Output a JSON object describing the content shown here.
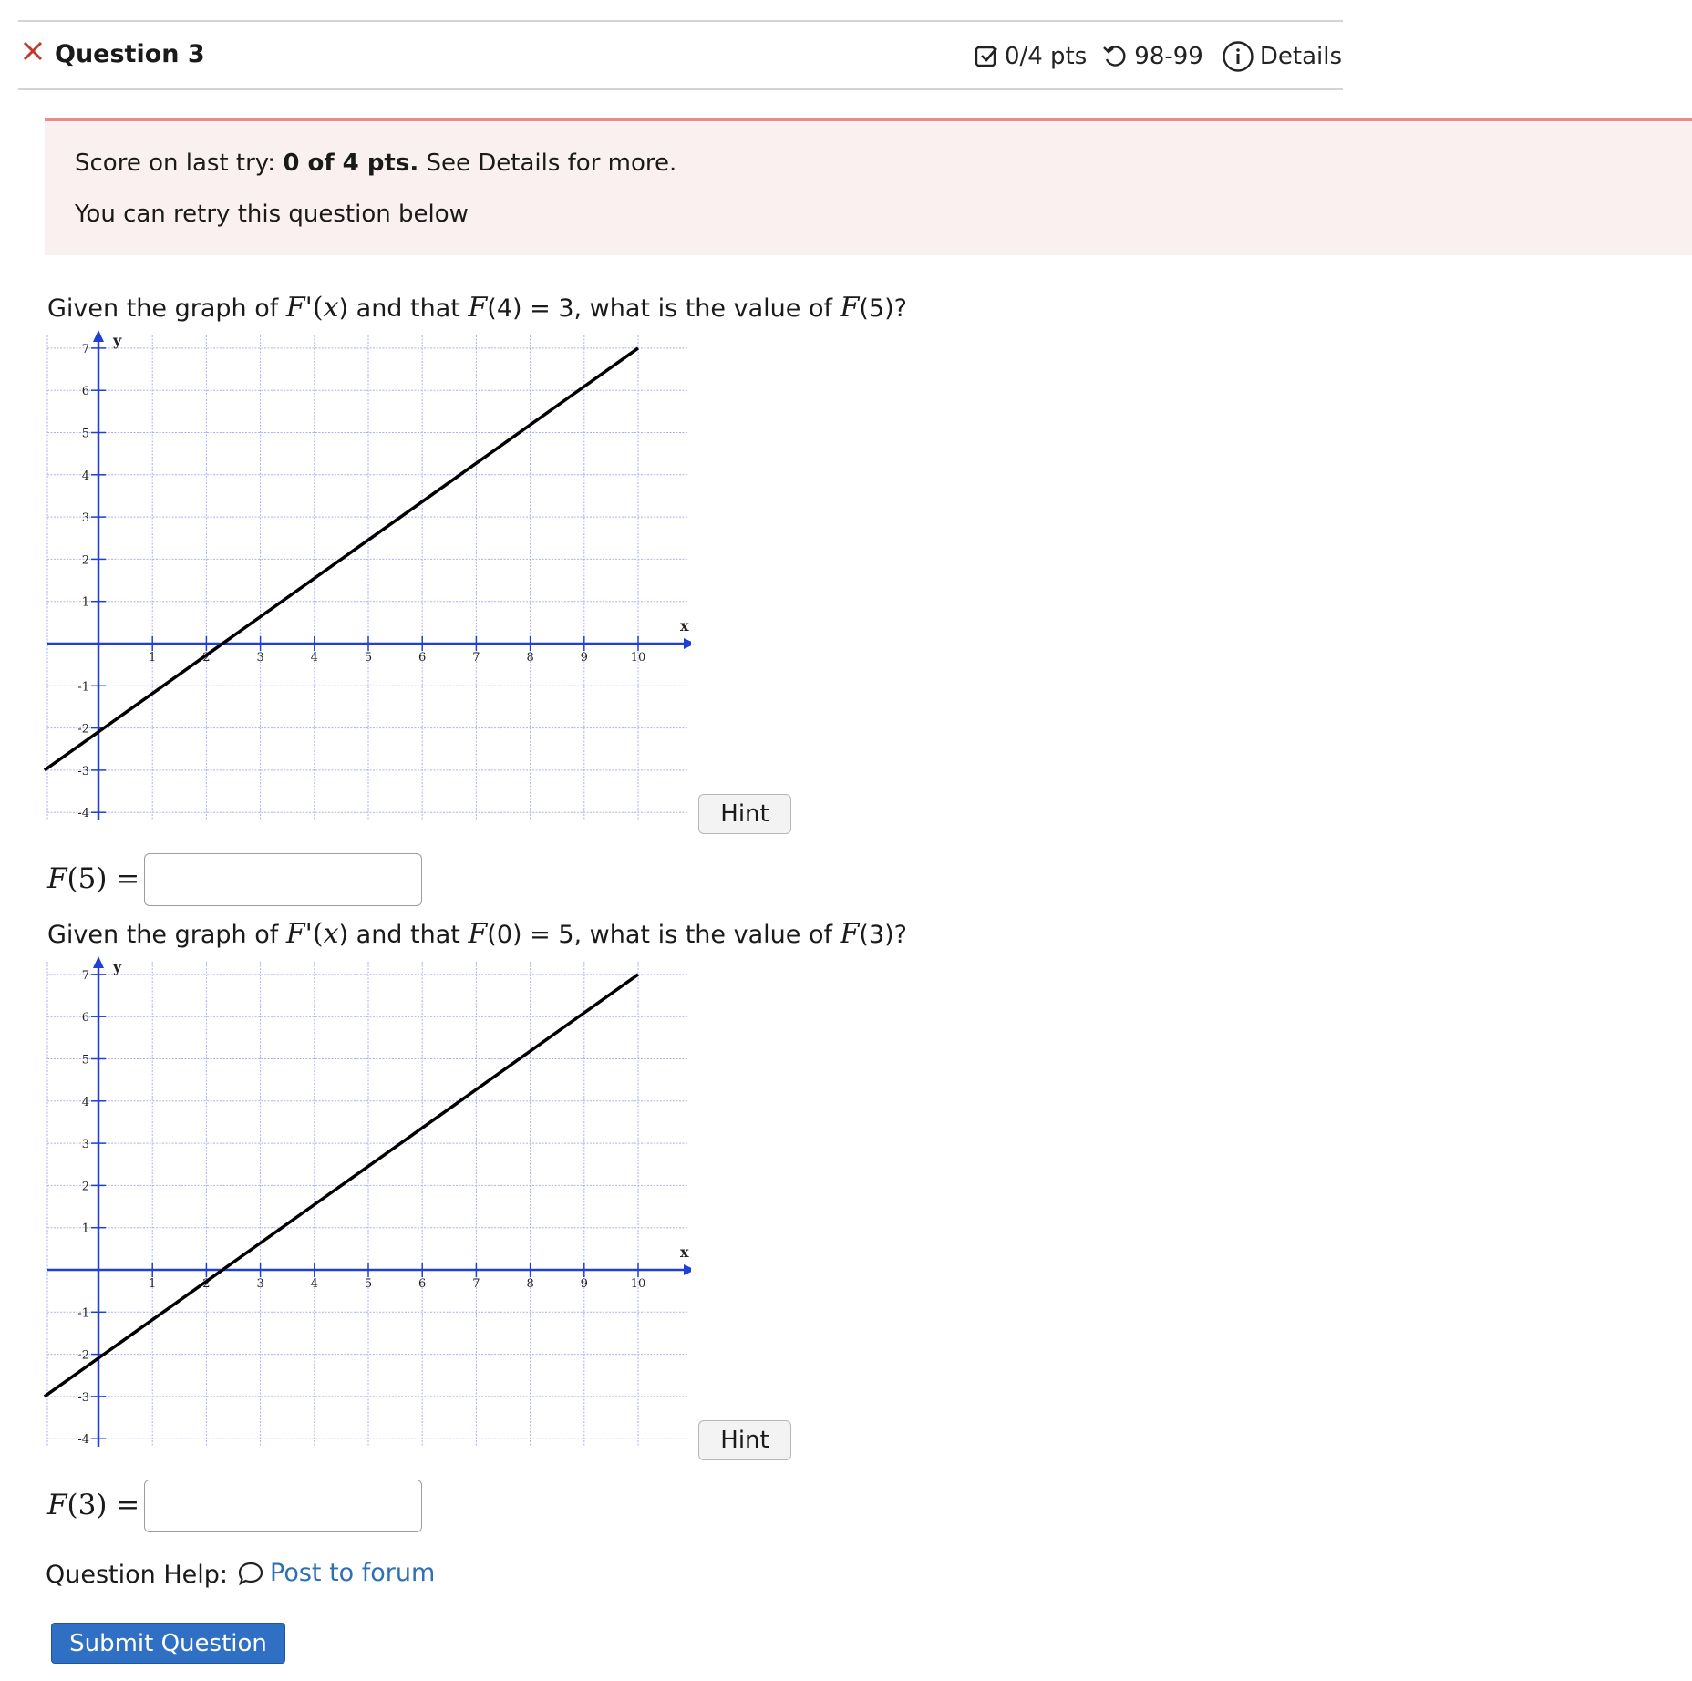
{
  "header": {
    "title": "Question 3",
    "points": "0/4 pts",
    "attempts": "98-99",
    "details": "Details"
  },
  "alert": {
    "score_prefix": "Score on last try: ",
    "score_value": "0 of 4 pts.",
    "score_suffix": " See Details for more.",
    "retry": "You can retry this question below"
  },
  "questions": [
    {
      "text_parts": [
        "Given the graph of ",
        "F",
        "'(",
        "x",
        ") and that ",
        "F",
        "(4) = 3, what is the value of ",
        "F",
        "(5)?"
      ],
      "answer_label": "F(5) =",
      "answer_value": "",
      "hint_label": "Hint"
    },
    {
      "text_parts": [
        "Given the graph of ",
        "F",
        "'(",
        "x",
        ") and that ",
        "F",
        "(0) = 5, what is the value of ",
        "F",
        "(3)?"
      ],
      "answer_label": "F(3) =",
      "answer_value": "",
      "hint_label": "Hint"
    }
  ],
  "chart_data": [
    {
      "type": "line",
      "xlabel": "x",
      "ylabel": "y",
      "xlim": [
        -1,
        11
      ],
      "ylim": [
        -4,
        7
      ],
      "x_ticks": [
        "1",
        "2",
        "3",
        "4",
        "5",
        "6",
        "7",
        "8",
        "9",
        "10"
      ],
      "y_ticks": [
        "7",
        "6",
        "5",
        "4",
        "3",
        "2",
        "1",
        "-1",
        "-2",
        "-3",
        "-4"
      ],
      "grid": true,
      "series": [
        {
          "x": [
            -1,
            10
          ],
          "y": [
            -3.0,
            7.0
          ],
          "color": "#000000"
        }
      ]
    },
    {
      "type": "line",
      "xlabel": "x",
      "ylabel": "y",
      "xlim": [
        -1,
        11
      ],
      "ylim": [
        -4,
        7
      ],
      "x_ticks": [
        "1",
        "2",
        "3",
        "4",
        "5",
        "6",
        "7",
        "8",
        "9",
        "10"
      ],
      "y_ticks": [
        "7",
        "6",
        "5",
        "4",
        "3",
        "2",
        "1",
        "-1",
        "-2",
        "-3",
        "-4"
      ],
      "grid": true,
      "series": [
        {
          "x": [
            -1,
            10
          ],
          "y": [
            -3.0,
            7.0
          ],
          "color": "#000000"
        }
      ]
    }
  ],
  "help": {
    "label": "Question Help:",
    "link": "Post to forum"
  },
  "submit_label": "Submit Question",
  "colors": {
    "axis": "#1f3fd6",
    "grid": "#a9b2f0",
    "alert_bg": "#fbf0f0",
    "alert_border": "#e98c8c",
    "link": "#2f6fb5",
    "submit_bg": "#2f70c5",
    "error_x": "#c0392b"
  }
}
